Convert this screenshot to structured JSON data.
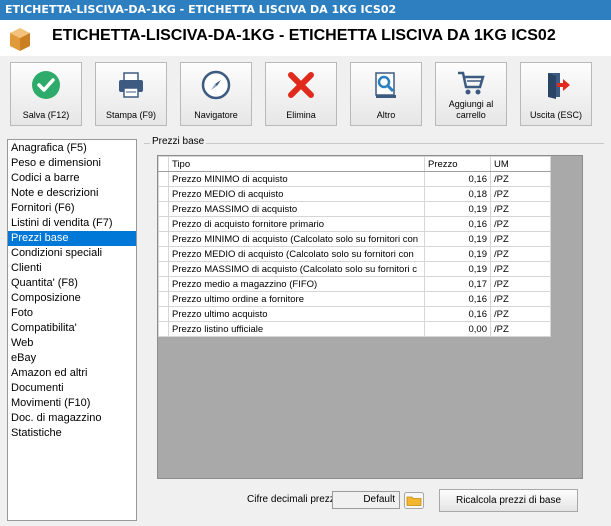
{
  "window": {
    "title": "ETICHETTA-LISCIVA-DA-1KG - ETICHETTA LISCIVA DA 1KG ICS02"
  },
  "header": {
    "title": "ETICHETTA-LISCIVA-DA-1KG - ETICHETTA LISCIVA DA 1KG ICS02"
  },
  "toolbar": {
    "save": "Salva (F12)",
    "print": "Stampa (F9)",
    "navigator": "Navigatore",
    "delete": "Elimina",
    "other": "Altro",
    "cart_line1": "Aggiungi al",
    "cart_line2": "carrello",
    "exit": "Uscita (ESC)"
  },
  "sidebar": {
    "items": [
      "Anagrafica (F5)",
      "Peso e dimensioni",
      "Codici a barre",
      "Note e descrizioni",
      "Fornitori (F6)",
      "Listini di vendita (F7)",
      "Prezzi base",
      "Condizioni speciali",
      "Clienti",
      "Quantita' (F8)",
      "Composizione",
      "Foto",
      "Compatibilita'",
      "Web",
      "eBay",
      "Amazon ed altri",
      "Documenti",
      "Movimenti (F10)",
      "Doc. di magazzino",
      "Statistiche"
    ],
    "selected_index": 6
  },
  "panel": {
    "group_label": "Prezzi base"
  },
  "grid": {
    "columns": [
      "Tipo",
      "Prezzo",
      "UM"
    ],
    "rows": [
      [
        "Prezzo MINIMO di acquisto",
        "0,16",
        "/PZ"
      ],
      [
        "Prezzo MEDIO di acquisto",
        "0,18",
        "/PZ"
      ],
      [
        "Prezzo MASSIMO di acquisto",
        "0,19",
        "/PZ"
      ],
      [
        "Prezzo di acquisto fornitore primario",
        "0,16",
        "/PZ"
      ],
      [
        "Prezzo MINIMO di acquisto (Calcolato solo su fornitori con",
        "0,19",
        "/PZ"
      ],
      [
        "Prezzo MEDIO di acquisto (Calcolato solo su fornitori con",
        "0,19",
        "/PZ"
      ],
      [
        "Prezzo MASSIMO di acquisto (Calcolato solo su fornitori c",
        "0,19",
        "/PZ"
      ],
      [
        "Prezzo medio a magazzino (FIFO)",
        "0,17",
        "/PZ"
      ],
      [
        "Prezzo ultimo ordine a fornitore",
        "0,16",
        "/PZ"
      ],
      [
        "Prezzo ultimo acquisto",
        "0,16",
        "/PZ"
      ],
      [
        "Prezzo listino ufficiale",
        "0,00",
        "/PZ"
      ]
    ]
  },
  "bottom": {
    "decimals_label": "Cifre decimali prezzi base :",
    "decimals_value": "Default",
    "recalc_button": "Ricalcola prezzi di base"
  },
  "colors": {
    "titlebar": "#2d7fc0",
    "selection": "#0078d7",
    "save_green": "#2eaa6a",
    "delete_red": "#e02a1c"
  }
}
